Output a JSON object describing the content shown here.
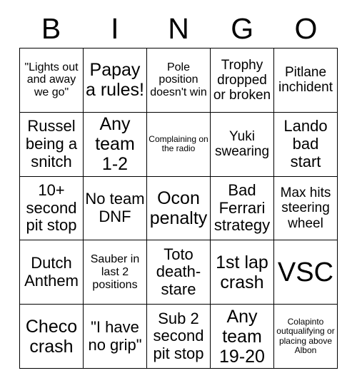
{
  "card": {
    "header_letters": [
      "B",
      "I",
      "N",
      "G",
      "O"
    ],
    "grid_size": "5x5",
    "colors": {
      "background": "#ffffff",
      "text": "#000000",
      "border": "#000000"
    },
    "rows": [
      [
        {
          "text": "\"Lights out and away we go\"",
          "size": "sm"
        },
        {
          "text": "Papaya rules!",
          "size": "xl"
        },
        {
          "text": "Pole position doesn't win",
          "size": "sm"
        },
        {
          "text": "Trophy dropped or broken",
          "size": "md"
        },
        {
          "text": "Pitlane inchident",
          "size": "md"
        }
      ],
      [
        {
          "text": "Russel being a snitch",
          "size": "lg"
        },
        {
          "text": "Any team 1-2",
          "size": "xl"
        },
        {
          "text": "Complaining on the radio",
          "size": "xs"
        },
        {
          "text": "Yuki swearing",
          "size": "md"
        },
        {
          "text": "Lando bad start",
          "size": "lg"
        }
      ],
      [
        {
          "text": "10+ second pit stop",
          "size": "lg"
        },
        {
          "text": "No team DNF",
          "size": "lg"
        },
        {
          "text": "Ocon penalty",
          "size": "xl"
        },
        {
          "text": "Bad Ferrari strategy",
          "size": "lg"
        },
        {
          "text": "Max hits steering wheel",
          "size": "md"
        }
      ],
      [
        {
          "text": "Dutch Anthem",
          "size": "lg"
        },
        {
          "text": "Sauber in last 2 positions",
          "size": "sm"
        },
        {
          "text": "Toto death-stare",
          "size": "lg"
        },
        {
          "text": "1st lap crash",
          "size": "xl"
        },
        {
          "text": "VSC",
          "size": "xxl"
        }
      ],
      [
        {
          "text": "Checo crash",
          "size": "xl"
        },
        {
          "text": "\"I have no grip\"",
          "size": "lg"
        },
        {
          "text": "Sub 2 second pit stop",
          "size": "lg"
        },
        {
          "text": "Any team 19-20",
          "size": "xl"
        },
        {
          "text": "Colapinto outqualifying or placing above Albon",
          "size": "xs"
        }
      ]
    ]
  }
}
